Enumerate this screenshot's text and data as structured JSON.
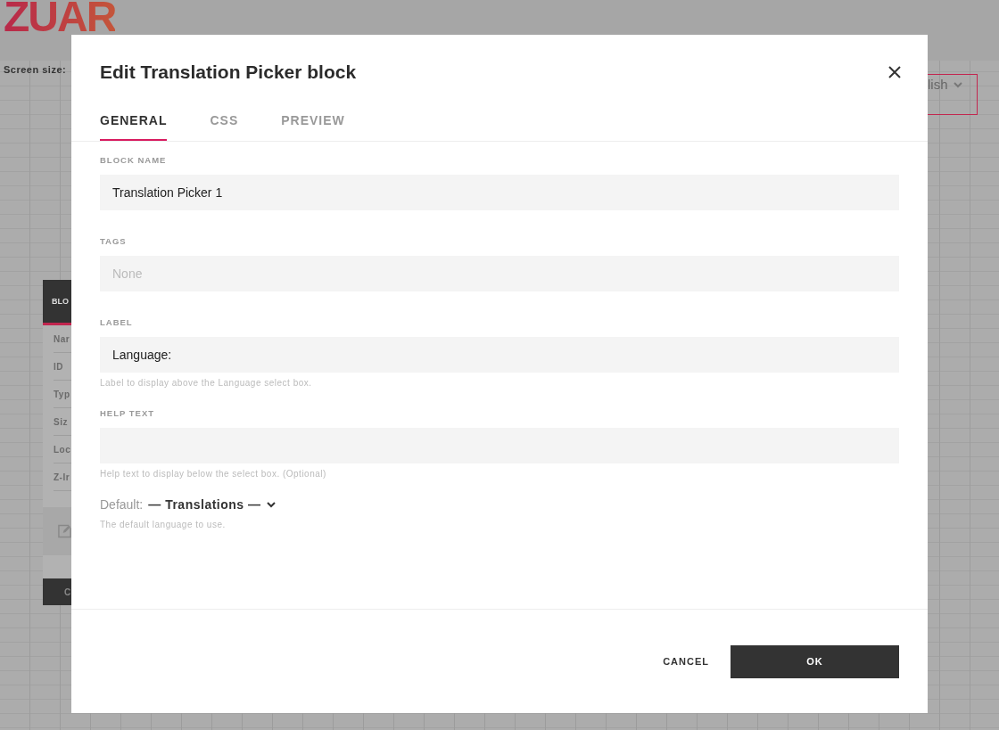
{
  "background": {
    "logo": "ZUAR",
    "screen_size_label": "Screen size:",
    "panel": {
      "title": "BLO",
      "rows": [
        "Nar",
        "ID",
        "Typ",
        "Siz",
        "Loc",
        "Z-Ir"
      ],
      "button": "C"
    },
    "language_select": {
      "value": "lish"
    }
  },
  "dialog": {
    "title": "Edit Translation Picker block",
    "tabs": [
      {
        "label": "GENERAL",
        "selected": true
      },
      {
        "label": "CSS",
        "selected": false
      },
      {
        "label": "PREVIEW",
        "selected": false
      }
    ],
    "fields": [
      {
        "label": "BLOCK NAME",
        "value": "Translation Picker 1"
      },
      {
        "label": "TAGS",
        "placeholder": "None"
      },
      {
        "label": "LABEL",
        "value": "Language:",
        "hint": "Label to display above the Language select box."
      },
      {
        "label": "HELP TEXT",
        "hint": "Help text to display below the select box. (Optional)"
      }
    ],
    "default": {
      "label": "Default:",
      "value": "— Translations —",
      "hint": "The default language to use."
    },
    "buttons": [
      {
        "label": "CANCEL",
        "kind": "text"
      },
      {
        "label": "OK",
        "kind": "primary"
      }
    ]
  }
}
